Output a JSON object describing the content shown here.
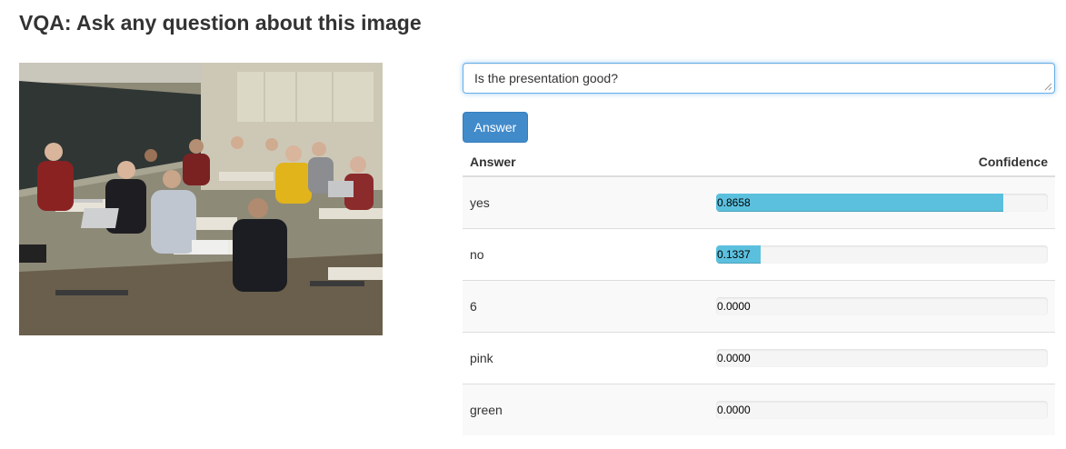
{
  "page": {
    "title": "VQA: Ask any question about this image"
  },
  "image": {
    "alt": "Classroom of students seated at desks"
  },
  "question": {
    "value": "Is the presentation good?"
  },
  "answer_button": {
    "label": "Answer"
  },
  "results": {
    "headers": {
      "answer": "Answer",
      "confidence": "Confidence"
    },
    "rows": [
      {
        "answer": "yes",
        "confidence_label": "0.8658",
        "confidence": 0.8658
      },
      {
        "answer": "no",
        "confidence_label": "0.1337",
        "confidence": 0.1337
      },
      {
        "answer": "6",
        "confidence_label": "0.0000",
        "confidence": 0.0
      },
      {
        "answer": "pink",
        "confidence_label": "0.0000",
        "confidence": 0.0
      },
      {
        "answer": "green",
        "confidence_label": "0.0000",
        "confidence": 0.0
      }
    ]
  },
  "colors": {
    "accent": "#428bca",
    "bar_fill": "#5bc0de",
    "focus_ring": "#66afe9"
  }
}
